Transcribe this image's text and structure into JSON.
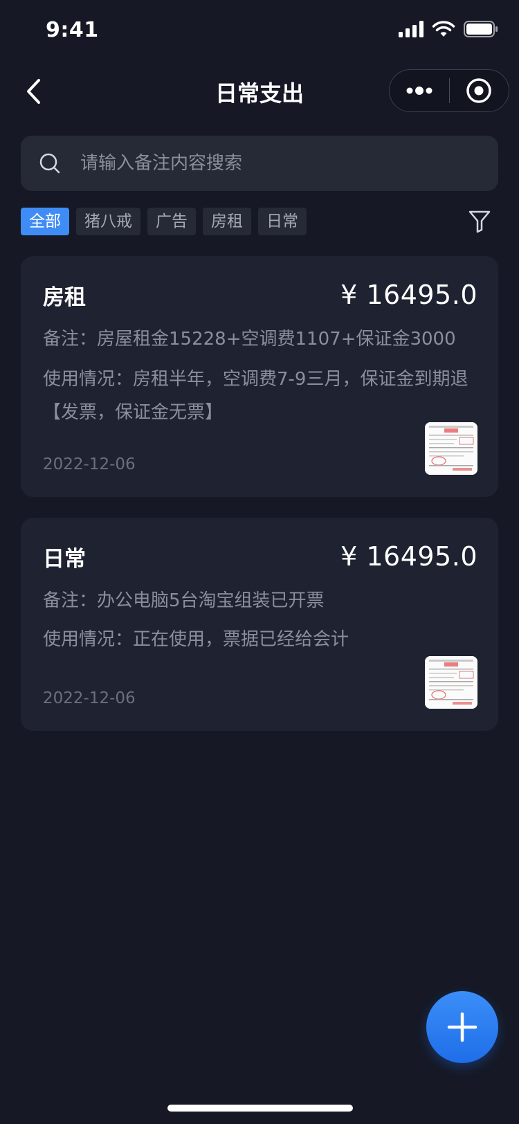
{
  "status_bar": {
    "time": "9:41"
  },
  "nav": {
    "title": "日常支出"
  },
  "search": {
    "placeholder": "请输入备注内容搜索"
  },
  "tags": [
    {
      "label": "全部",
      "active": true
    },
    {
      "label": "猪八戒",
      "active": false
    },
    {
      "label": "广告",
      "active": false
    },
    {
      "label": "房租",
      "active": false
    },
    {
      "label": "日常",
      "active": false
    }
  ],
  "records": [
    {
      "category": "房租",
      "amount": "¥ 16495.0",
      "note": "备注：房屋租金15228+空调费1107+保证金3000",
      "usage": "使用情况：房租半年，空调费7-9三月，保证金到期退【发票，保证金无票】",
      "date": "2022-12-06"
    },
    {
      "category": "日常",
      "amount": "¥ 16495.0",
      "note": "备注：办公电脑5台淘宝组装已开票",
      "usage": "使用情况：正在使用，票据已经给会计",
      "date": "2022-12-06"
    }
  ],
  "colors": {
    "background": "#161925",
    "card": "#1f2230",
    "accent": "#3f8cf6",
    "muted_text": "#8b8f9c"
  },
  "icons": {
    "back": "chevron-left-icon",
    "more": "more-dots-icon",
    "close": "target-circle-icon",
    "search": "search-icon",
    "filter": "filter-funnel-icon",
    "add": "plus-icon"
  }
}
